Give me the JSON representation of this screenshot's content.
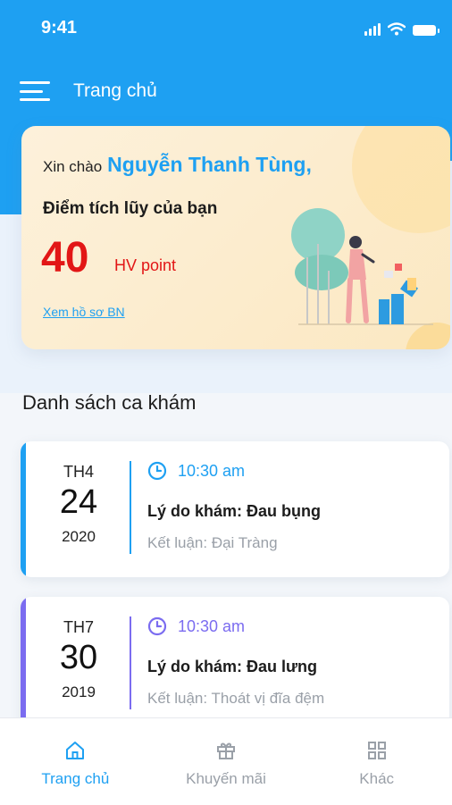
{
  "status_bar": {
    "time": "9:41"
  },
  "header": {
    "title": "Trang chủ"
  },
  "promo": {
    "greeting": "Xin chào",
    "user_name": "Nguyễn Thanh Tùng,",
    "points_label": "Điểm tích lũy của bạn",
    "points_value": "40",
    "points_unit": "HV point",
    "profile_link": "Xem hồ sơ BN"
  },
  "visits_section": {
    "title": "Danh sách ca khám"
  },
  "visits": [
    {
      "weekday": "TH4",
      "day": "24",
      "year": "2020",
      "time": "10:30 am",
      "reason": "Lý do khám: Đau bụng",
      "conclusion": "Kết luận: Đại Tràng",
      "accent_color": "#1ea0f2"
    },
    {
      "weekday": "TH7",
      "day": "30",
      "year": "2019",
      "time": "10:30 am",
      "reason": "Lý do khám: Đau lưng",
      "conclusion": "Kết luận: Thoát vị đĩa đệm",
      "accent_color": "#7b6cf0"
    }
  ],
  "bottom_nav": [
    {
      "label": "Trang chủ",
      "icon": "home-icon",
      "active": true
    },
    {
      "label": "Khuyến mãi",
      "icon": "gift-icon",
      "active": false
    },
    {
      "label": "Khác",
      "icon": "grid-icon",
      "active": false
    }
  ],
  "colors": {
    "primary": "#1ea0f2",
    "points": "#e21616",
    "secondary_accent": "#7b6cf0",
    "inactive": "#9aa0a8"
  }
}
